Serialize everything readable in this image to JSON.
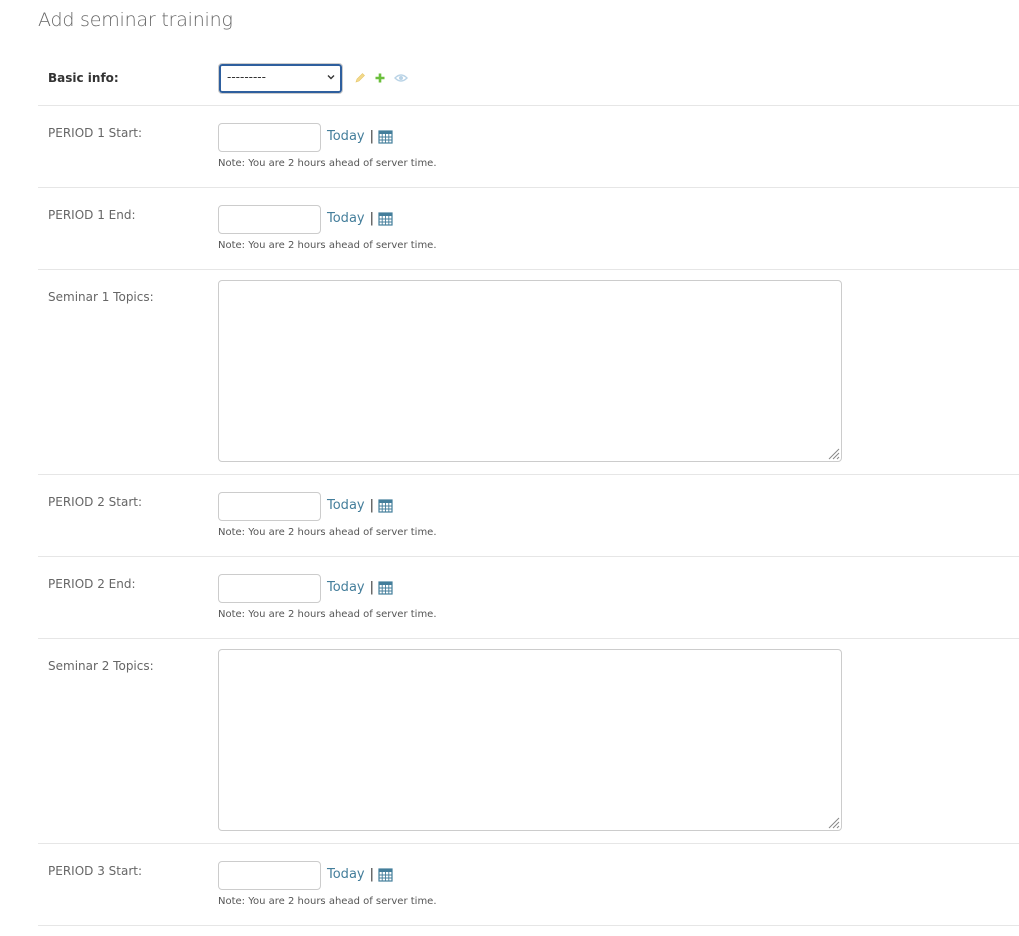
{
  "page": {
    "title": "Add seminar training"
  },
  "basic_info": {
    "label": "Basic info:",
    "selected": "---------",
    "icons": [
      "pencil-icon",
      "plus-icon",
      "eye-icon"
    ]
  },
  "common": {
    "today_label": "Today",
    "separator": "|",
    "note": "Note: You are 2 hours ahead of server time."
  },
  "fields": {
    "p1_start": {
      "label": "PERIOD 1 Start:",
      "value": ""
    },
    "p1_end": {
      "label": "PERIOD 1 End:",
      "value": ""
    },
    "s1_topics": {
      "label": "Seminar 1 Topics:",
      "value": ""
    },
    "p2_start": {
      "label": "PERIOD 2 Start:",
      "value": ""
    },
    "p2_end": {
      "label": "PERIOD 2 End:",
      "value": ""
    },
    "s2_topics": {
      "label": "Seminar 2 Topics:",
      "value": ""
    },
    "p3_start": {
      "label": "PERIOD 3 Start:",
      "value": ""
    }
  },
  "colors": {
    "link": "#447e9b",
    "focus_border": "#2e5f9e",
    "pencil": "#f3d98a",
    "plus": "#6bbf3c",
    "eye": "#b9d3e6"
  }
}
